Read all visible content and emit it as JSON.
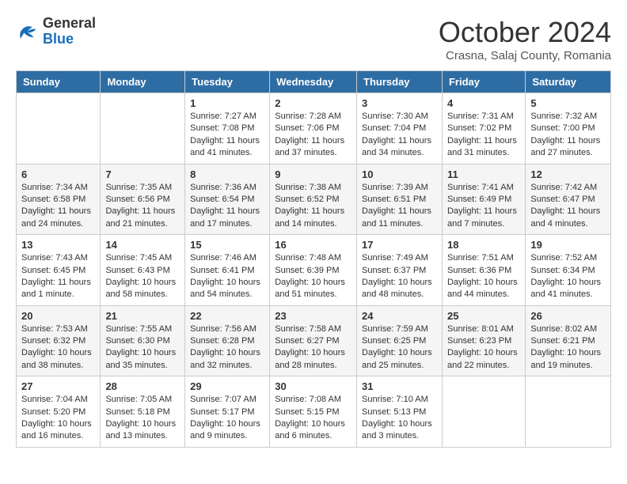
{
  "logo": {
    "general": "General",
    "blue": "Blue"
  },
  "title": "October 2024",
  "location": "Crasna, Salaj County, Romania",
  "days_of_week": [
    "Sunday",
    "Monday",
    "Tuesday",
    "Wednesday",
    "Thursday",
    "Friday",
    "Saturday"
  ],
  "weeks": [
    [
      {
        "day": "",
        "info": ""
      },
      {
        "day": "",
        "info": ""
      },
      {
        "day": "1",
        "info": "Sunrise: 7:27 AM\nSunset: 7:08 PM\nDaylight: 11 hours and 41 minutes."
      },
      {
        "day": "2",
        "info": "Sunrise: 7:28 AM\nSunset: 7:06 PM\nDaylight: 11 hours and 37 minutes."
      },
      {
        "day": "3",
        "info": "Sunrise: 7:30 AM\nSunset: 7:04 PM\nDaylight: 11 hours and 34 minutes."
      },
      {
        "day": "4",
        "info": "Sunrise: 7:31 AM\nSunset: 7:02 PM\nDaylight: 11 hours and 31 minutes."
      },
      {
        "day": "5",
        "info": "Sunrise: 7:32 AM\nSunset: 7:00 PM\nDaylight: 11 hours and 27 minutes."
      }
    ],
    [
      {
        "day": "6",
        "info": "Sunrise: 7:34 AM\nSunset: 6:58 PM\nDaylight: 11 hours and 24 minutes."
      },
      {
        "day": "7",
        "info": "Sunrise: 7:35 AM\nSunset: 6:56 PM\nDaylight: 11 hours and 21 minutes."
      },
      {
        "day": "8",
        "info": "Sunrise: 7:36 AM\nSunset: 6:54 PM\nDaylight: 11 hours and 17 minutes."
      },
      {
        "day": "9",
        "info": "Sunrise: 7:38 AM\nSunset: 6:52 PM\nDaylight: 11 hours and 14 minutes."
      },
      {
        "day": "10",
        "info": "Sunrise: 7:39 AM\nSunset: 6:51 PM\nDaylight: 11 hours and 11 minutes."
      },
      {
        "day": "11",
        "info": "Sunrise: 7:41 AM\nSunset: 6:49 PM\nDaylight: 11 hours and 7 minutes."
      },
      {
        "day": "12",
        "info": "Sunrise: 7:42 AM\nSunset: 6:47 PM\nDaylight: 11 hours and 4 minutes."
      }
    ],
    [
      {
        "day": "13",
        "info": "Sunrise: 7:43 AM\nSunset: 6:45 PM\nDaylight: 11 hours and 1 minute."
      },
      {
        "day": "14",
        "info": "Sunrise: 7:45 AM\nSunset: 6:43 PM\nDaylight: 10 hours and 58 minutes."
      },
      {
        "day": "15",
        "info": "Sunrise: 7:46 AM\nSunset: 6:41 PM\nDaylight: 10 hours and 54 minutes."
      },
      {
        "day": "16",
        "info": "Sunrise: 7:48 AM\nSunset: 6:39 PM\nDaylight: 10 hours and 51 minutes."
      },
      {
        "day": "17",
        "info": "Sunrise: 7:49 AM\nSunset: 6:37 PM\nDaylight: 10 hours and 48 minutes."
      },
      {
        "day": "18",
        "info": "Sunrise: 7:51 AM\nSunset: 6:36 PM\nDaylight: 10 hours and 44 minutes."
      },
      {
        "day": "19",
        "info": "Sunrise: 7:52 AM\nSunset: 6:34 PM\nDaylight: 10 hours and 41 minutes."
      }
    ],
    [
      {
        "day": "20",
        "info": "Sunrise: 7:53 AM\nSunset: 6:32 PM\nDaylight: 10 hours and 38 minutes."
      },
      {
        "day": "21",
        "info": "Sunrise: 7:55 AM\nSunset: 6:30 PM\nDaylight: 10 hours and 35 minutes."
      },
      {
        "day": "22",
        "info": "Sunrise: 7:56 AM\nSunset: 6:28 PM\nDaylight: 10 hours and 32 minutes."
      },
      {
        "day": "23",
        "info": "Sunrise: 7:58 AM\nSunset: 6:27 PM\nDaylight: 10 hours and 28 minutes."
      },
      {
        "day": "24",
        "info": "Sunrise: 7:59 AM\nSunset: 6:25 PM\nDaylight: 10 hours and 25 minutes."
      },
      {
        "day": "25",
        "info": "Sunrise: 8:01 AM\nSunset: 6:23 PM\nDaylight: 10 hours and 22 minutes."
      },
      {
        "day": "26",
        "info": "Sunrise: 8:02 AM\nSunset: 6:21 PM\nDaylight: 10 hours and 19 minutes."
      }
    ],
    [
      {
        "day": "27",
        "info": "Sunrise: 7:04 AM\nSunset: 5:20 PM\nDaylight: 10 hours and 16 minutes."
      },
      {
        "day": "28",
        "info": "Sunrise: 7:05 AM\nSunset: 5:18 PM\nDaylight: 10 hours and 13 minutes."
      },
      {
        "day": "29",
        "info": "Sunrise: 7:07 AM\nSunset: 5:17 PM\nDaylight: 10 hours and 9 minutes."
      },
      {
        "day": "30",
        "info": "Sunrise: 7:08 AM\nSunset: 5:15 PM\nDaylight: 10 hours and 6 minutes."
      },
      {
        "day": "31",
        "info": "Sunrise: 7:10 AM\nSunset: 5:13 PM\nDaylight: 10 hours and 3 minutes."
      },
      {
        "day": "",
        "info": ""
      },
      {
        "day": "",
        "info": ""
      }
    ]
  ]
}
